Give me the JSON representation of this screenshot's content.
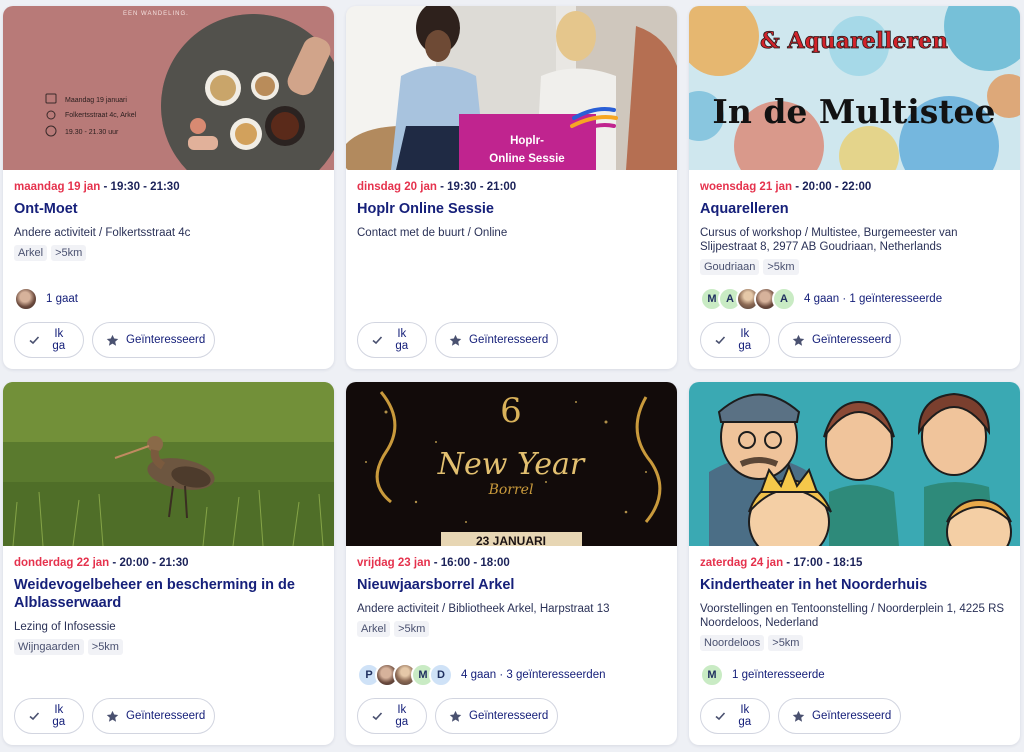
{
  "events": [
    {
      "date": "maandag 19 jan",
      "time": "19:30 - 21:30",
      "title": "Ont-Moet",
      "location": "Andere activiteit / Folkertsstraat 4c",
      "tags": [
        "Arkel",
        ">5km"
      ],
      "attendance": "1 gaat",
      "image": {
        "caption_top": "EEN WANDELING.",
        "info_date": "Maandag 19 januari",
        "info_place": "Folkertsstraat 4c, Arkel",
        "info_time": "19.30 - 21.30 uur"
      }
    },
    {
      "date": "dinsdag 20 jan",
      "time": "19:30 - 21:00",
      "title": "Hoplr Online Sessie",
      "location": "Contact met de buurt / Online",
      "tags": [],
      "attendance": "",
      "image": {
        "label_line1": "Hoplr-",
        "label_line2": "Online Sessie"
      }
    },
    {
      "date": "woensdag 21 jan",
      "time": "20:00 - 22:00",
      "title": "Aquarelleren",
      "location": "Cursus of workshop / Multistee, Burgemeester van Slijpestraat 8, 2977 AB Goudriaan, Netherlands",
      "tags": [
        "Goudriaan",
        ">5km"
      ],
      "attendance": "4 gaan · 1 geïnteresseerde",
      "avatars": [
        "M",
        "A",
        "",
        "",
        "A"
      ],
      "image": {
        "line1": "& Aquarelleren",
        "line2": "In de Multistee"
      }
    },
    {
      "date": "donderdag 22 jan",
      "time": "20:00 - 21:30",
      "title": "Weidevogelbeheer en bescherming in de Alblasserwaard",
      "location": "Lezing of Infosessie",
      "tags": [
        "Wijngaarden",
        ">5km"
      ],
      "attendance": ""
    },
    {
      "date": "vrijdag 23 jan",
      "time": "16:00 - 18:00",
      "title": "Nieuwjaarsborrel Arkel",
      "location": "Andere activiteit / Bibliotheek Arkel, Harpstraat 13",
      "tags": [
        "Arkel",
        ">5km"
      ],
      "attendance": "4 gaan · 3 geïnteresseerden",
      "avatars": [
        "P",
        "",
        "",
        "M",
        "D"
      ],
      "image": {
        "line1": "New Year",
        "line2": "Borrel",
        "line3": "23 JANUARI"
      }
    },
    {
      "date": "zaterdag 24 jan",
      "time": "17:00 - 18:15",
      "title": "Kindertheater in het Noorderhuis",
      "location": "Voorstellingen en Tentoonstelling / Noorderplein 1, 4225 RS Noordeloos, Nederland",
      "tags": [
        "Noordeloos",
        ">5km"
      ],
      "attendance": "1 geïnteresseerde",
      "avatars": [
        "M"
      ]
    }
  ],
  "buttons": {
    "going": "Ik ga",
    "interested": "Geïnteresseerd"
  },
  "separator": "-",
  "colors": {
    "date": "#e5324d",
    "title": "#16207a",
    "accent_pink": "#c0248f"
  }
}
